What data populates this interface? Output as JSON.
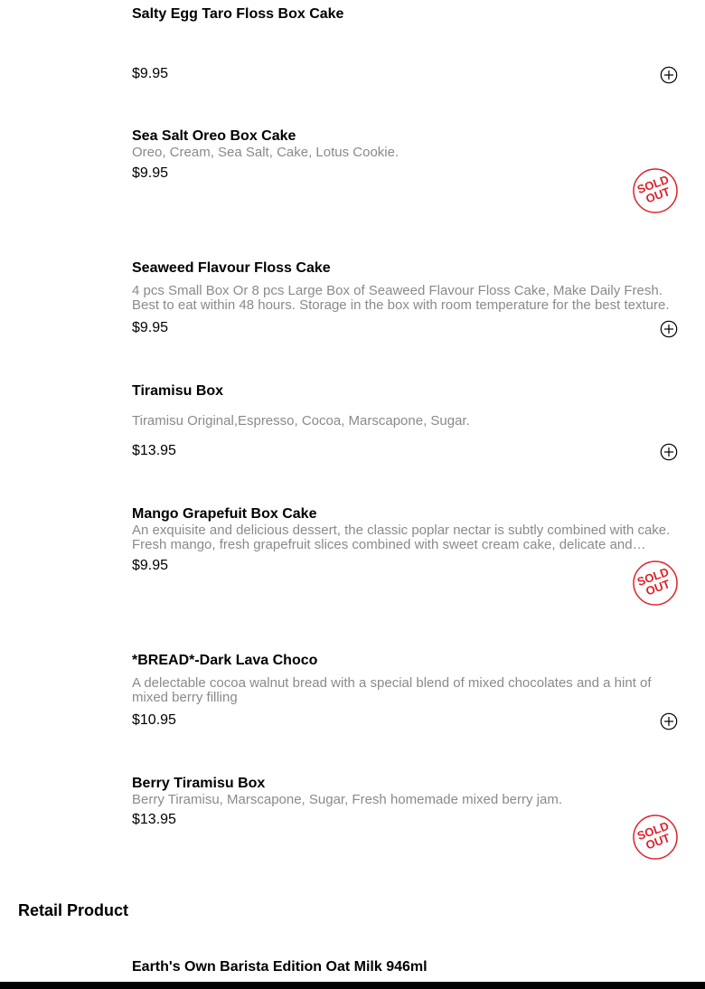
{
  "items": [
    {
      "name": "Salty Egg Taro Floss Box Cake",
      "description": "",
      "price": "$9.95",
      "status": "available"
    },
    {
      "name": "Sea Salt Oreo Box Cake",
      "description": "Oreo, Cream, Sea Salt, Cake, Lotus Cookie.",
      "price": "$9.95",
      "status": "sold_out"
    },
    {
      "name": "Seaweed Flavour Floss Cake",
      "description": "4 pcs Small Box Or 8 pcs Large Box of Seaweed Flavour Floss Cake, Make Daily Fresh. Best to eat within 48 hours. Storage in the box with room temperature for the best texture.",
      "price": "$9.95",
      "status": "available"
    },
    {
      "name": "Tiramisu Box",
      "description": "Tiramisu Original,Espresso, Cocoa, Marscapone, Sugar.",
      "price": "$13.95",
      "status": "available"
    },
    {
      "name": "Mango Grapefuit Box Cake",
      "description": "An exquisite and delicious dessert, the classic poplar nectar is subtly combined with cake. Fresh mango, fresh grapefruit slices combined with sweet cream cake, delicate and smooth.",
      "price": "$9.95",
      "status": "sold_out"
    },
    {
      "name": "*BREAD*-Dark Lava Choco",
      "description": "A delectable cocoa walnut bread with a special blend of mixed chocolates and a hint of mixed berry filling",
      "price": "$10.95",
      "status": "available"
    },
    {
      "name": "Berry Tiramisu Box",
      "description": "Berry Tiramisu, Marscapone, Sugar, Fresh homemade mixed berry jam.",
      "price": "$13.95",
      "status": "sold_out"
    }
  ],
  "section": {
    "title": "Retail Product"
  },
  "retail_items": [
    {
      "name": "Earth's Own Barista Edition Oat Milk 946ml"
    }
  ],
  "badge": {
    "line1": "SOLD",
    "line2": "OUT",
    "color": "#e0202a"
  },
  "icons": {
    "add": "plus-circle-icon",
    "sold_out": "sold-out-badge-icon"
  }
}
